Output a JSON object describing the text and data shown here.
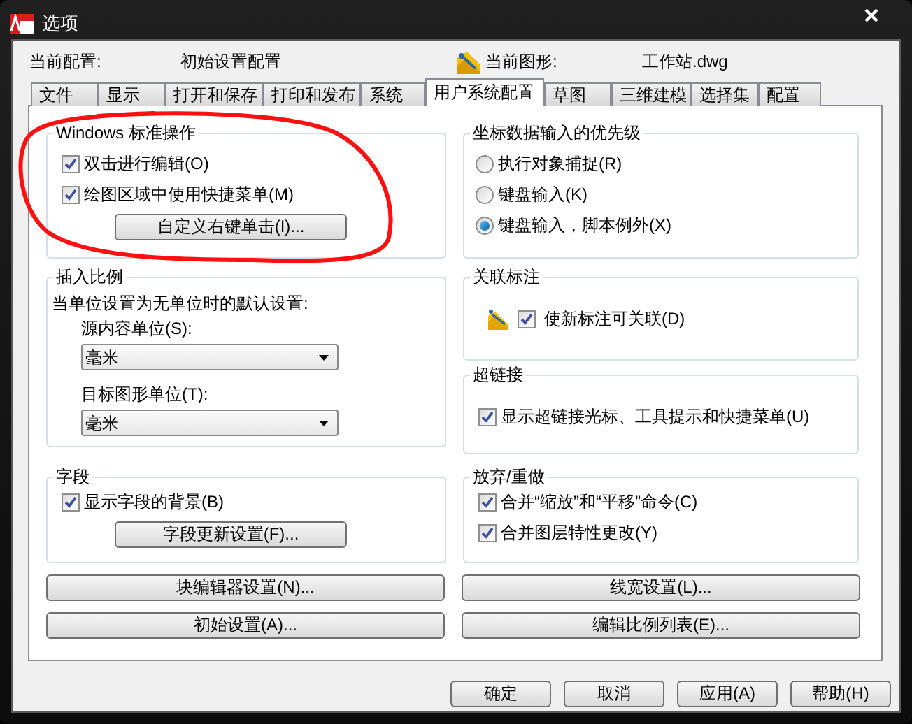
{
  "window": {
    "title": "选项"
  },
  "header": {
    "profile_label": "当前配置:",
    "profile": "初始设置配置",
    "drawing_label": "当前图形:",
    "drawing": "工作站.dwg"
  },
  "tabs": [
    {
      "label": "文件",
      "selected": false
    },
    {
      "label": "显示",
      "selected": false
    },
    {
      "label": "打开和保存",
      "selected": false
    },
    {
      "label": "打印和发布",
      "selected": false
    },
    {
      "label": "系统",
      "selected": false
    },
    {
      "label": "用户系统配置",
      "selected": true
    },
    {
      "label": "草图",
      "selected": false
    },
    {
      "label": "三维建模",
      "selected": false
    },
    {
      "label": "选择集",
      "selected": false
    },
    {
      "label": "配置",
      "selected": false
    }
  ],
  "left_column": [
    {
      "title": "Windows 标准操作",
      "items": [
        {
          "kind": "checkbox",
          "label": "双击进行编辑(O)",
          "checked": true
        },
        {
          "kind": "checkbox",
          "label": "绘图区域中使用快捷菜单(M)",
          "checked": true
        },
        {
          "kind": "button",
          "label": "自定义右键单击(I)..."
        }
      ]
    },
    {
      "title": "插入比例",
      "items": [
        {
          "kind": "text",
          "label": "当单位设置为无单位时的默认设置:"
        },
        {
          "kind": "dropdown",
          "label": "源内容单位(S):",
          "value": "毫米"
        },
        {
          "kind": "dropdown",
          "label": "目标图形单位(T):",
          "value": "毫米"
        }
      ]
    },
    {
      "title": "字段",
      "items": [
        {
          "kind": "checkbox",
          "label": "显示字段的背景(B)",
          "checked": true
        },
        {
          "kind": "button",
          "label": "字段更新设置(F)..."
        }
      ]
    }
  ],
  "right_column": [
    {
      "title": "坐标数据输入的优先级",
      "items": [
        {
          "kind": "radio",
          "label": "执行对象捕捉(R)",
          "selected": false
        },
        {
          "kind": "radio",
          "label": "键盘输入(K)",
          "selected": false
        },
        {
          "kind": "radio",
          "label": "键盘输入，脚本例外(X)",
          "selected": true
        }
      ]
    },
    {
      "title": "关联标注",
      "items": [
        {
          "kind": "icon-checkbox",
          "label": "使新标注可关联(D)",
          "checked": true
        }
      ]
    },
    {
      "title": "超链接",
      "items": [
        {
          "kind": "checkbox",
          "label": "显示超链接光标、工具提示和快捷菜单(U)",
          "checked": true
        }
      ]
    },
    {
      "title": "放弃/重做",
      "items": [
        {
          "kind": "checkbox",
          "label": "合并“缩放”和“平移”命令(C)",
          "checked": true
        },
        {
          "kind": "checkbox",
          "label": "合并图层特性更改(Y)",
          "checked": true
        }
      ]
    }
  ],
  "wide_buttons": [
    [
      "块编辑器设置(N)...",
      "线宽设置(L)..."
    ],
    [
      "初始设置(A)...",
      "编辑比例列表(E)..."
    ]
  ],
  "buttons": [
    "确定",
    "取消",
    "应用(A)",
    "帮助(H)"
  ],
  "annotation": {
    "kind": "ellipse"
  }
}
